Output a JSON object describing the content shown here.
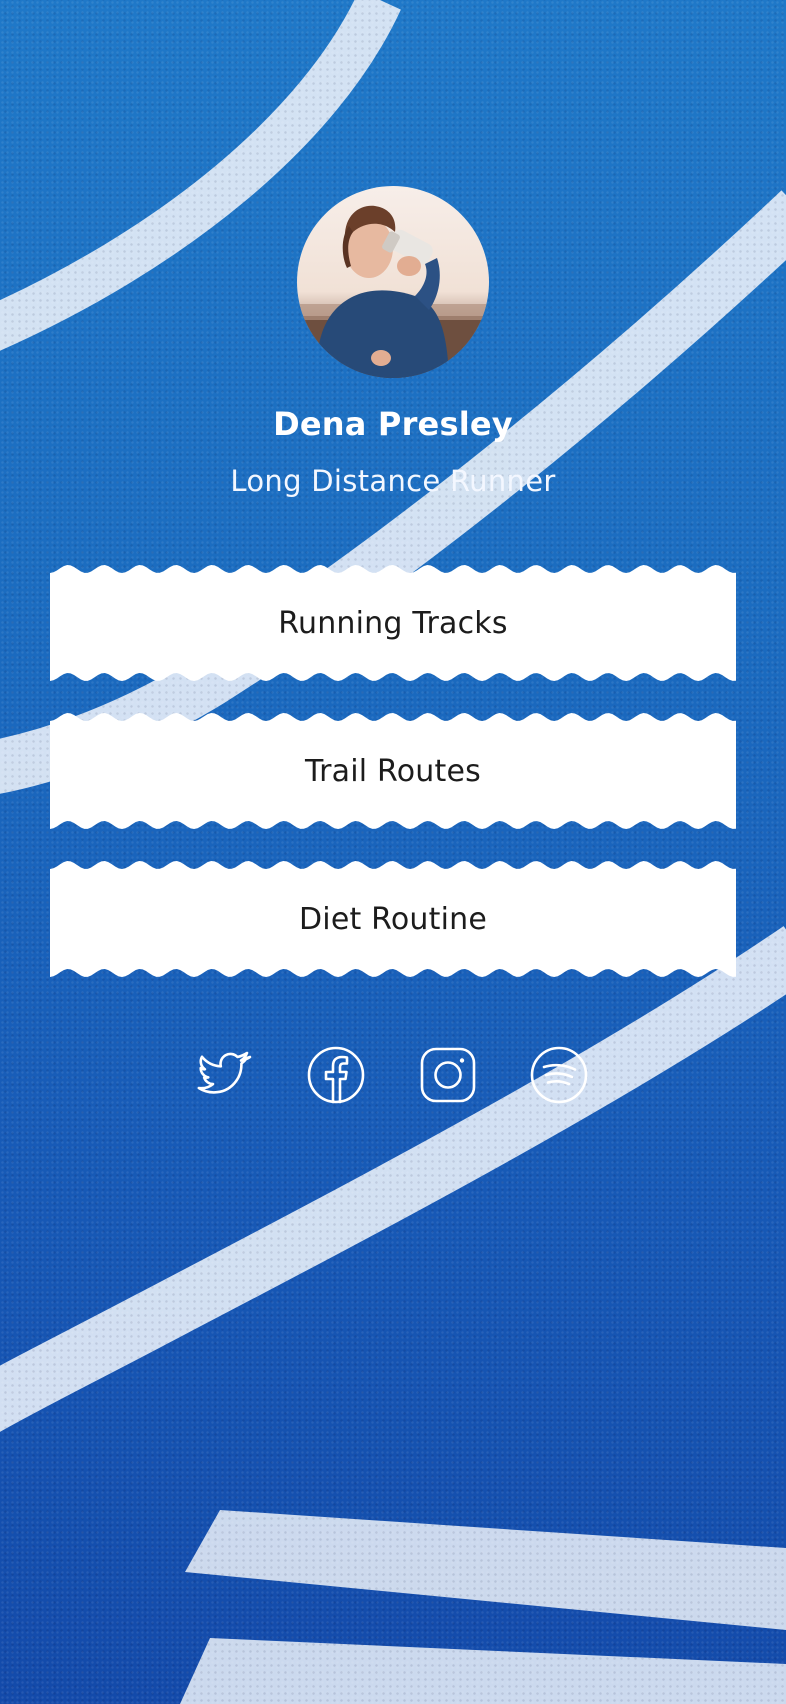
{
  "profile": {
    "name": "Dena Presley",
    "subtitle": "Long Distance Runner"
  },
  "links": [
    {
      "label": "Running Tracks"
    },
    {
      "label": "Trail Routes"
    },
    {
      "label": "Diet Routine"
    }
  ],
  "socials": [
    {
      "icon": "twitter-icon"
    },
    {
      "icon": "facebook-icon"
    },
    {
      "icon": "instagram-icon"
    },
    {
      "icon": "spotify-icon"
    }
  ],
  "colors": {
    "track_blue": "#1b6cc0",
    "button_bg": "#ffffff",
    "text_dark": "#1c1c1c",
    "text_light": "#ffffff"
  }
}
